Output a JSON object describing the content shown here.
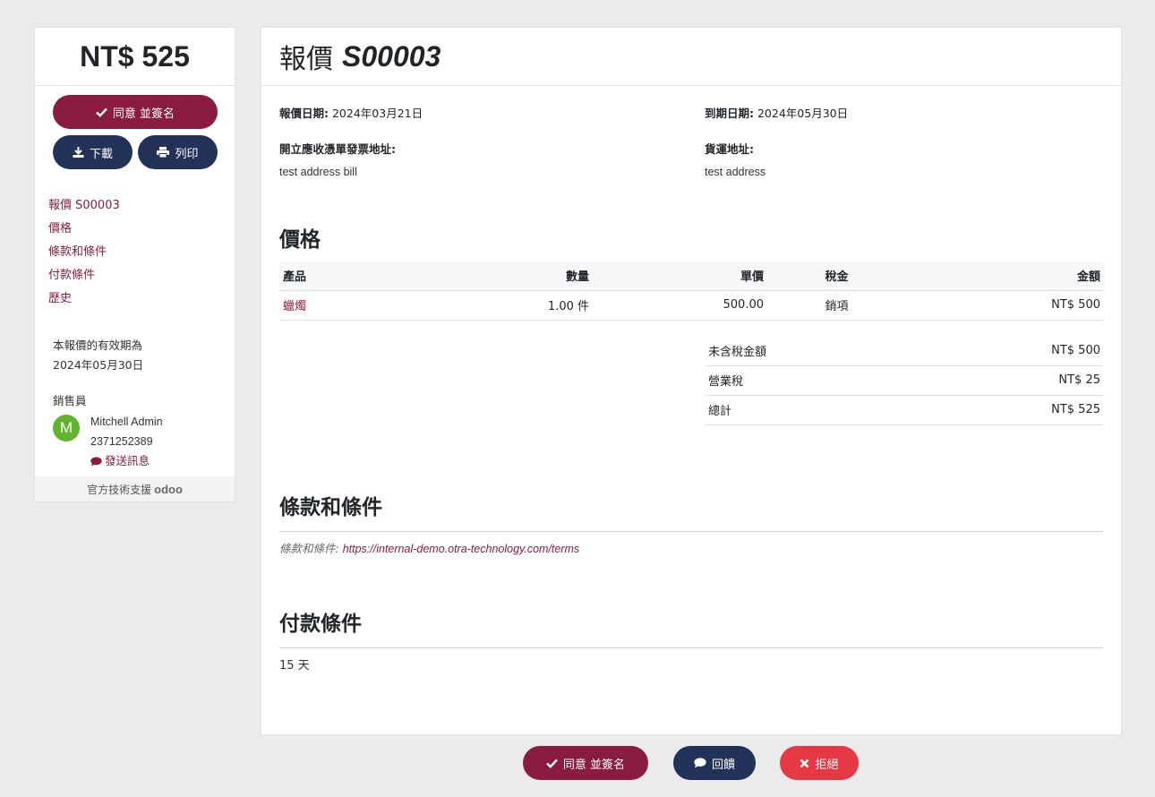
{
  "sidebar": {
    "amount": "NT$ 525",
    "accept_sign": "同意 並簽名",
    "download": "下載",
    "print": "列印",
    "nav": [
      "報價 S00003",
      "價格",
      "條款和條件",
      "付款條件",
      "歷史"
    ],
    "validity_text": "本報價的有效期為",
    "validity_date": "2024年05月30日",
    "salesperson_label": "銷售員",
    "salesperson_initial": "M",
    "salesperson_name": "Mitchell Admin",
    "salesperson_phone": "2371252389",
    "send_message": "發送訊息",
    "support_text": "官方技術支援",
    "odoo_logo": "odoo"
  },
  "header": {
    "title_prefix": "報價",
    "title_ref": "S00003"
  },
  "info": {
    "quote_date_label": "報價日期:",
    "quote_date": "2024年03月21日",
    "expiry_label": "到期日期:",
    "expiry_date": "2024年05月30日",
    "invoice_addr_label": "開立應收憑單發票地址:",
    "invoice_addr": "test address bill",
    "shipping_addr_label": "貨運地址:",
    "shipping_addr": "test address"
  },
  "pricing": {
    "heading": "價格",
    "columns": [
      "產品",
      "數量",
      "單價",
      "稅金",
      "金額"
    ],
    "rows": [
      {
        "product": "蠟燭",
        "qty": "1.00 件",
        "unit_price": "500.00",
        "tax": "銷項",
        "amount": "NT$ 500"
      }
    ],
    "subtotal_label": "未含稅金額",
    "subtotal": "NT$ 500",
    "tax_label": "營業稅",
    "tax": "NT$ 25",
    "total_label": "總計",
    "total": "NT$ 525"
  },
  "terms": {
    "heading": "條款和條件",
    "label": "條款和條件:",
    "url": "https://internal-demo.otra-technology.com/terms"
  },
  "payment": {
    "heading": "付款條件",
    "value": "15 天"
  },
  "bottom": {
    "accept_sign": "同意 並簽名",
    "feedback": "回饋",
    "reject": "拒絕"
  },
  "colors": {
    "primary": "#8a1d3f",
    "navy": "#223258",
    "danger": "#e53946",
    "avatar": "#64b32e"
  }
}
